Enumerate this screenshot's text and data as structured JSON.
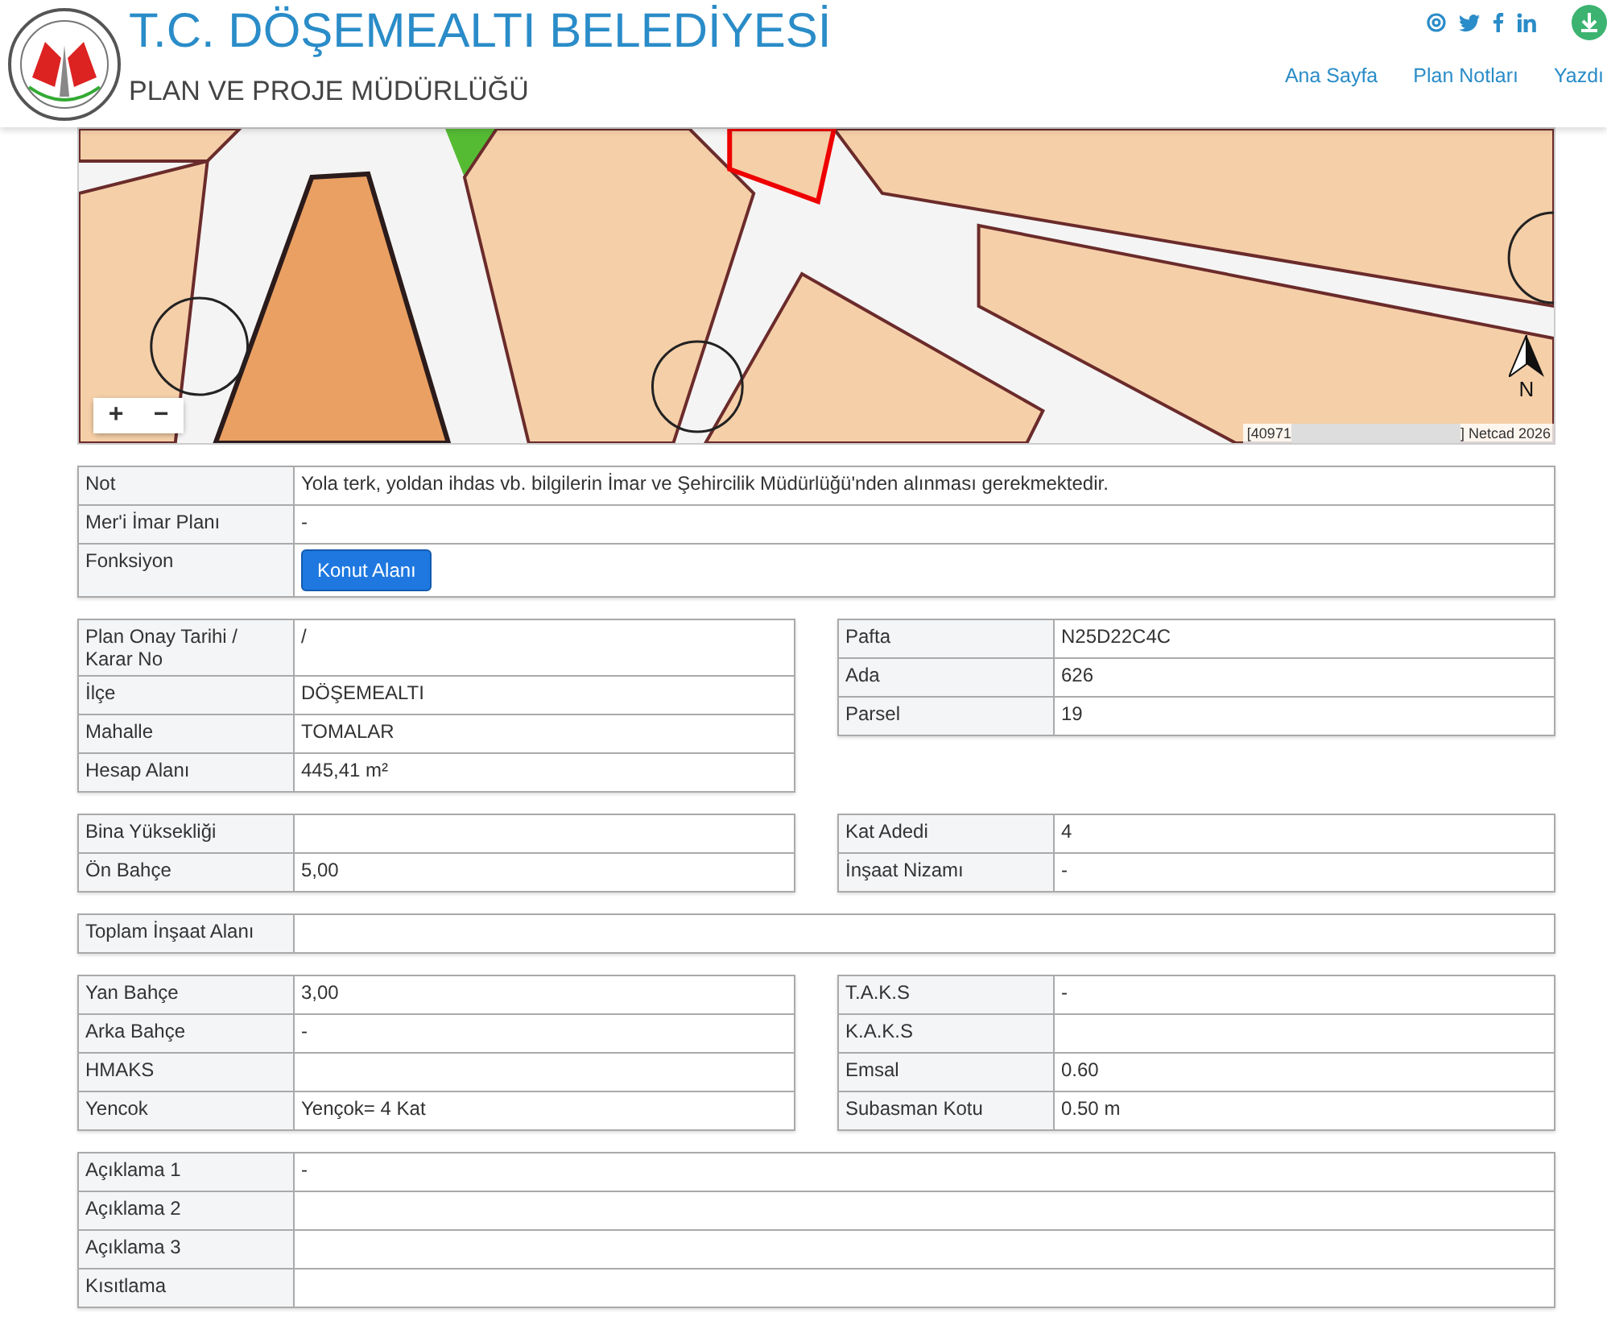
{
  "header": {
    "title": "T.C. DÖŞEMEALTI BELEDİYESİ",
    "subtitle": "PLAN VE PROJE MÜDÜRLÜĞÜ",
    "nav": [
      {
        "label": "Ana Sayfa"
      },
      {
        "label": "Plan Notları"
      },
      {
        "label": "Yazdı"
      }
    ]
  },
  "map": {
    "zoom_in": "+",
    "zoom_out": "−",
    "attribution_start": "[40971",
    "attribution_end": "] Netcad 2026",
    "compass_label": "N"
  },
  "sections": [
    {
      "kind": "full",
      "rows": [
        {
          "label": "Not",
          "value": "Yola terk, yoldan ihdas vb. bilgilerin İmar ve Şehircilik Müdürlüğü'nden alınması gerekmektedir."
        },
        {
          "label": "Mer'i İmar Planı",
          "value": "-"
        },
        {
          "label": "Fonksiyon",
          "value": "Konut Alanı",
          "kind": "button"
        }
      ]
    },
    {
      "kind": "split",
      "left": [
        {
          "label": "Plan Onay Tarihi / Karar No",
          "value": "/"
        },
        {
          "label": "İlçe",
          "value": "DÖŞEMEALTI"
        },
        {
          "label": "Mahalle",
          "value": "TOMALAR"
        },
        {
          "label": "Hesap Alanı",
          "value": "445,41 m²"
        }
      ],
      "right": [
        {
          "label": "Pafta",
          "value": "N25D22C4C"
        },
        {
          "label": "Ada",
          "value": "626"
        },
        {
          "label": "Parsel",
          "value": "19"
        }
      ]
    },
    {
      "kind": "split",
      "left": [
        {
          "label": "Bina Yüksekliği"
        },
        {
          "label": "Ön Bahçe",
          "value": "5,00"
        }
      ],
      "right": [
        {
          "label": "Kat Adedi",
          "value": "4"
        },
        {
          "label": "İnşaat Nizamı",
          "value": "-"
        }
      ]
    },
    {
      "kind": "full",
      "rows": [
        {
          "label": "Toplam İnşaat Alanı"
        }
      ]
    },
    {
      "kind": "split",
      "left": [
        {
          "label": "Yan Bahçe",
          "value": "3,00"
        },
        {
          "label": "Arka Bahçe",
          "value": "-"
        },
        {
          "label": "HMAKS"
        },
        {
          "label": "Yencok",
          "value": "Yençok= 4 Kat"
        }
      ],
      "right": [
        {
          "label": "T.A.K.S",
          "value": "-"
        },
        {
          "label": "K.A.K.S"
        },
        {
          "label": "Emsal",
          "value": "0.60"
        },
        {
          "label": "Subasman Kotu",
          "value": "0.50 m"
        }
      ]
    },
    {
      "kind": "full",
      "rows": [
        {
          "label": "Açıklama 1",
          "value": "-"
        },
        {
          "label": "Açıklama 2"
        },
        {
          "label": "Açıklama 3"
        },
        {
          "label": "Kısıtlama"
        }
      ]
    }
  ]
}
